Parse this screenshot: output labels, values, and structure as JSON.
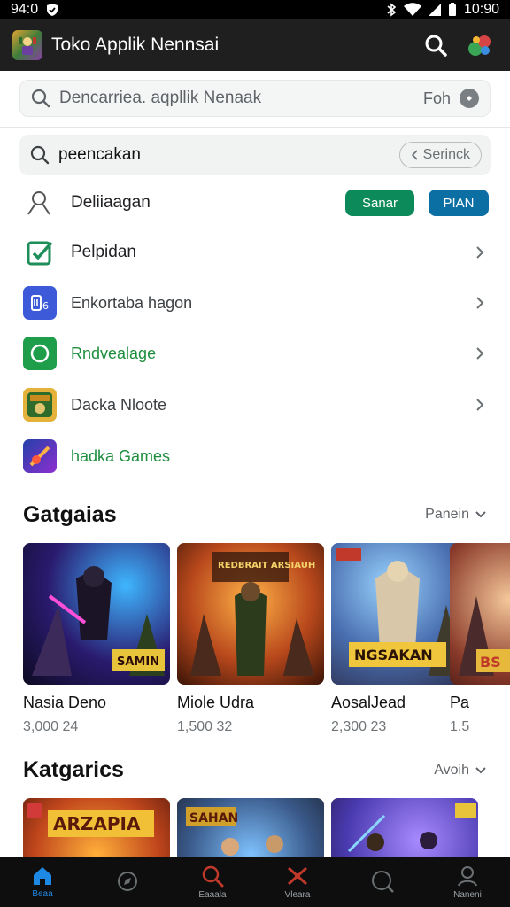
{
  "status_bar": {
    "time_left": "94:0",
    "time_right": "10:90"
  },
  "app_bar": {
    "title": "Toko Applik Nennsai"
  },
  "search_main": {
    "placeholder": "Dencarriea. aqpllik Nenaak",
    "right_text": "Foh"
  },
  "search_sub": {
    "value": "peencakan",
    "button_label": "Serinck"
  },
  "list": [
    {
      "label": "Deliiaagan",
      "btn1": "Sanar",
      "btn2": "PIAN",
      "icon": "search-person-icon"
    },
    {
      "label": "Pelpidan",
      "icon": "edit-check-icon"
    },
    {
      "label": "Enkortaba hagon",
      "icon": "document-icon"
    },
    {
      "label": "Rndvealage",
      "icon": "circle-icon"
    },
    {
      "label": "Dacka Nloote",
      "icon": "game-thumb-icon"
    },
    {
      "label": "hadka Games",
      "icon": "game-thumb-icon"
    }
  ],
  "section1": {
    "title": "Gatgaias",
    "more": "Panein"
  },
  "section1_cards": [
    {
      "name": "Nasia Deno",
      "meta": "3,000 24",
      "banner": "SAMIN"
    },
    {
      "name": "Miole Udra",
      "meta": "1,500 32",
      "banner": "REDBRAIT ARSIAUH"
    },
    {
      "name": "AosalJead",
      "meta": "2,300 23",
      "banner": "NGSAKAN"
    },
    {
      "name": "Pa",
      "meta": "1.5",
      "banner": "BS"
    }
  ],
  "section2": {
    "title": "Katgarics",
    "more": "Avoih"
  },
  "section2_cards": [
    {
      "banner": "ARZAPIA"
    },
    {
      "banner": "SAHAN"
    },
    {
      "banner": ""
    }
  ],
  "bottom_nav": [
    {
      "label": "Beaa",
      "icon": "home-icon",
      "active": true
    },
    {
      "label": "",
      "icon": "compass-icon",
      "active": false
    },
    {
      "label": "Eaaala",
      "icon": "search-icon",
      "active": false
    },
    {
      "label": "Vleara",
      "icon": "games-icon",
      "active": false
    },
    {
      "label": "",
      "icon": "chat-search-icon",
      "active": false
    },
    {
      "label": "Naneni",
      "icon": "profile-icon",
      "active": false
    }
  ],
  "colors": {
    "appbar": "#1f1f1f",
    "green_button": "#0d8a5a",
    "blue_button": "#0b6fa4",
    "active_nav": "#1e88e5"
  }
}
